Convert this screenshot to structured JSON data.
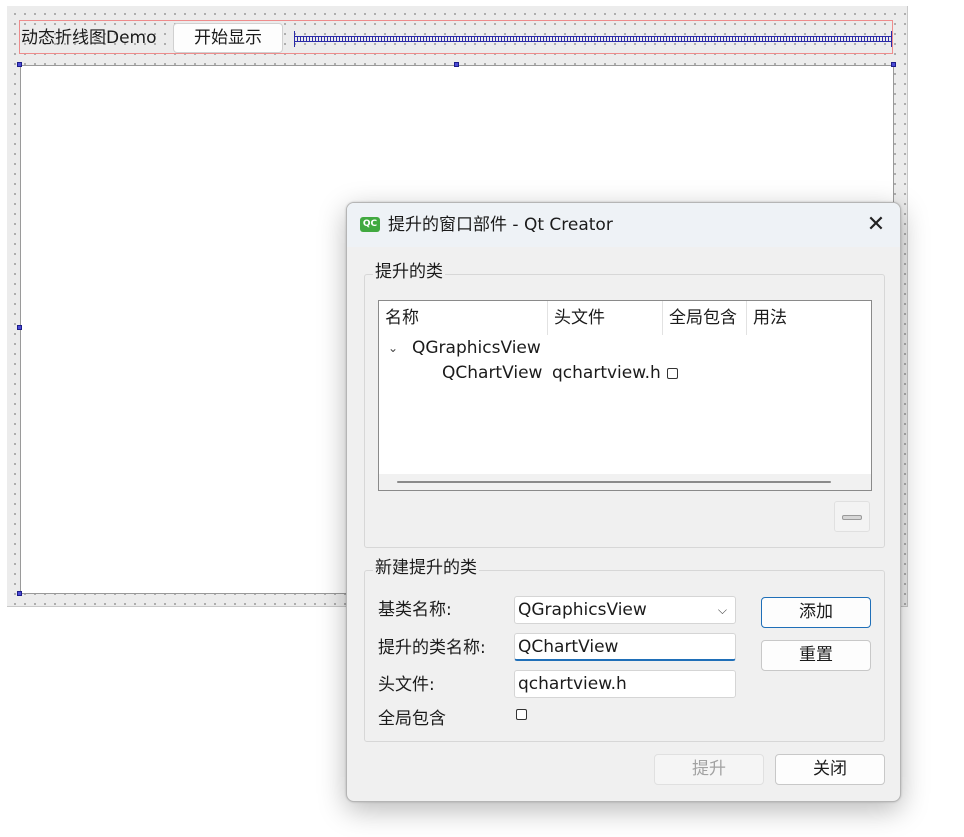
{
  "form": {
    "demo_label": "动态折线图Demo",
    "start_button": "开始显示"
  },
  "dialog": {
    "icon_text": "QC",
    "title": "提升的窗口部件 - Qt Creator",
    "promoted_group": {
      "title": "提升的类",
      "columns": [
        "名称",
        "头文件",
        "全局包含",
        "用法"
      ],
      "rows": [
        {
          "name": "QGraphicsView",
          "header": "",
          "global_include": null,
          "expanded": true
        },
        {
          "name": "QChartView",
          "header": "qchartview.h",
          "global_include": false
        }
      ]
    },
    "new_group": {
      "title": "新建提升的类",
      "base_class_label": "基类名称:",
      "base_class_value": "QGraphicsView",
      "promoted_class_label": "提升的类名称:",
      "promoted_class_value": "QChartView",
      "header_label": "头文件:",
      "header_value": "qchartview.h",
      "global_include_label": "全局包含",
      "global_include_checked": false,
      "add_button": "添加",
      "reset_button": "重置"
    },
    "promote_button": "提升",
    "close_button": "关闭"
  },
  "colors": {
    "accent": "#1f6fb8",
    "qc_icon": "#41a940",
    "selection_handle": "#4b4bd6",
    "layout_outline": "#ee8c8c"
  }
}
